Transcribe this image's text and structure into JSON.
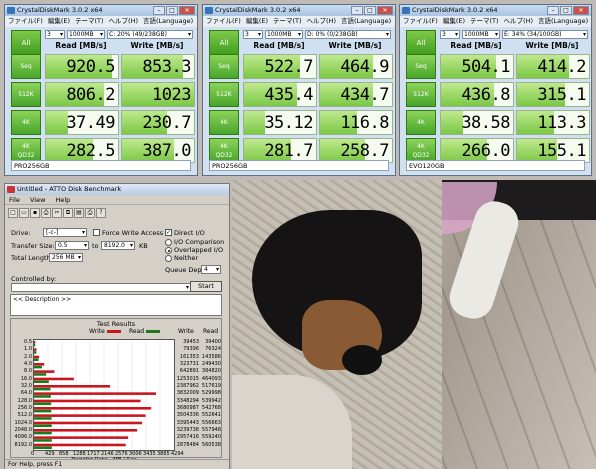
{
  "photo": {
    "description_icon": "dog-photo"
  },
  "cdm": [
    {
      "title": "CrystalDiskMark 3.0.2 x64",
      "menu": [
        "ファイル(F)",
        "編集(E)",
        "テーマ(T)",
        "ヘルプ(H)",
        "言語(Language)"
      ],
      "all_label": "All",
      "passes": "3",
      "size": "1000MB",
      "drive": "C: 20% (49/238GB)",
      "read_header": "Read [MB/s]",
      "write_header": "Write [MB/s]",
      "rows": [
        {
          "label": "Seq",
          "read": "920.5",
          "write": "853.3",
          "rfill": 0.92,
          "wfill": 0.85
        },
        {
          "label": "512K",
          "read": "806.2",
          "write": "1023",
          "rfill": 0.81,
          "wfill": 1.0
        },
        {
          "label": "4K",
          "read": "37.49",
          "write": "230.7",
          "rfill": 0.3,
          "wfill": 0.62
        },
        {
          "label1": "4K",
          "label2": "QD32",
          "read": "282.5",
          "write": "387.0",
          "rfill": 0.65,
          "wfill": 0.72
        }
      ],
      "note": "PRO256GB"
    },
    {
      "title": "CrystalDiskMark 3.0.2 x64",
      "menu": [
        "ファイル(F)",
        "編集(E)",
        "テーマ(T)",
        "ヘルプ(H)",
        "言語(Language)"
      ],
      "all_label": "All",
      "passes": "3",
      "size": "1000MB",
      "drive": "D: 0% (0/238GB)",
      "read_header": "Read [MB/s]",
      "write_header": "Write [MB/s]",
      "rows": [
        {
          "label": "Seq",
          "read": "522.7",
          "write": "464.9",
          "rfill": 0.78,
          "wfill": 0.74
        },
        {
          "label": "512K",
          "read": "435.4",
          "write": "434.7",
          "rfill": 0.73,
          "wfill": 0.73
        },
        {
          "label": "4K",
          "read": "35.12",
          "write": "116.8",
          "rfill": 0.29,
          "wfill": 0.52
        },
        {
          "label1": "4K",
          "label2": "QD32",
          "read": "281.7",
          "write": "258.7",
          "rfill": 0.65,
          "wfill": 0.63
        }
      ],
      "note": "PRO256GB"
    },
    {
      "title": "CrystalDiskMark 3.0.2 x64",
      "menu": [
        "ファイル(F)",
        "編集(E)",
        "テーマ(T)",
        "ヘルプ(H)",
        "言語(Language)"
      ],
      "all_label": "All",
      "passes": "3",
      "size": "1000MB",
      "drive": "E: 34% (34/100GB)",
      "read_header": "Read [MB/s]",
      "write_header": "Write [MB/s]",
      "rows": [
        {
          "label": "Seq",
          "read": "504.1",
          "write": "414.2",
          "rfill": 0.77,
          "wfill": 0.72
        },
        {
          "label": "512K",
          "read": "436.8",
          "write": "315.1",
          "rfill": 0.73,
          "wfill": 0.66
        },
        {
          "label": "4K",
          "read": "38.58",
          "write": "113.3",
          "rfill": 0.3,
          "wfill": 0.52
        },
        {
          "label1": "4K",
          "label2": "QD32",
          "read": "266.0",
          "write": "155.1",
          "rfill": 0.64,
          "wfill": 0.55
        }
      ],
      "note": "EVO120GB"
    }
  ],
  "atto": {
    "title": "Untitled - ATTO Disk Benchmark",
    "menu": [
      "File",
      "View",
      "Help"
    ],
    "drive_label": "Drive:",
    "drive_value": "[-c-]",
    "force_write": "Force Write Access",
    "direct_io": "Direct I/O",
    "transfer_label": "Transfer Size:",
    "transfer_from": "0.5",
    "to_label": "to",
    "transfer_to": "8192.0",
    "kb_label": "KB",
    "io_comparison": "I/O Comparison",
    "overlapped": "Overlapped I/O",
    "neither": "Neither",
    "total_label": "Total Length:",
    "total_value": "256 MB",
    "queue_label": "Queue Depth:",
    "queue_value": "4",
    "controlled_label": "Controlled by:",
    "start_label": "Start",
    "description": "<< Description >>",
    "results_title": "Test Results",
    "write_legend": "Write",
    "read_legend": "Read",
    "write_col": "Write",
    "read_col": "Read",
    "xlabel": "Transfer Rate - MB / Sec",
    "status": "For Help, press F1",
    "colors": {
      "write": "#c8171f",
      "read": "#1b7a1b"
    }
  },
  "chart_data": {
    "type": "bar",
    "title": "Test Results",
    "xlabel": "Transfer Rate - MB / Sec",
    "categories": [
      "0.5",
      "1.0",
      "2.0",
      "4.0",
      "8.0",
      "16.0",
      "32.0",
      "64.0",
      "128.0",
      "256.0",
      "512.0",
      "1024.0",
      "2048.0",
      "4096.0",
      "8192.0"
    ],
    "series": [
      {
        "name": "Write",
        "values": [
          39453,
          79396,
          161353,
          323731,
          642891,
          1253015,
          2387962,
          3832009,
          3348294,
          3680987,
          3504336,
          3395443,
          3239738,
          2957416,
          2878484
        ]
      },
      {
        "name": "Read",
        "values": [
          39400,
          76324,
          143586,
          249430,
          384820,
          464093,
          517619,
          529998,
          539942,
          542768,
          552641,
          556663,
          557948,
          559240,
          560538
        ]
      }
    ],
    "xticks": [
      "0",
      "429",
      "858",
      "1288",
      "1717",
      "2146",
      "2576",
      "3006",
      "3435",
      "3865",
      "4294"
    ],
    "xlim": [
      0,
      4294
    ]
  }
}
